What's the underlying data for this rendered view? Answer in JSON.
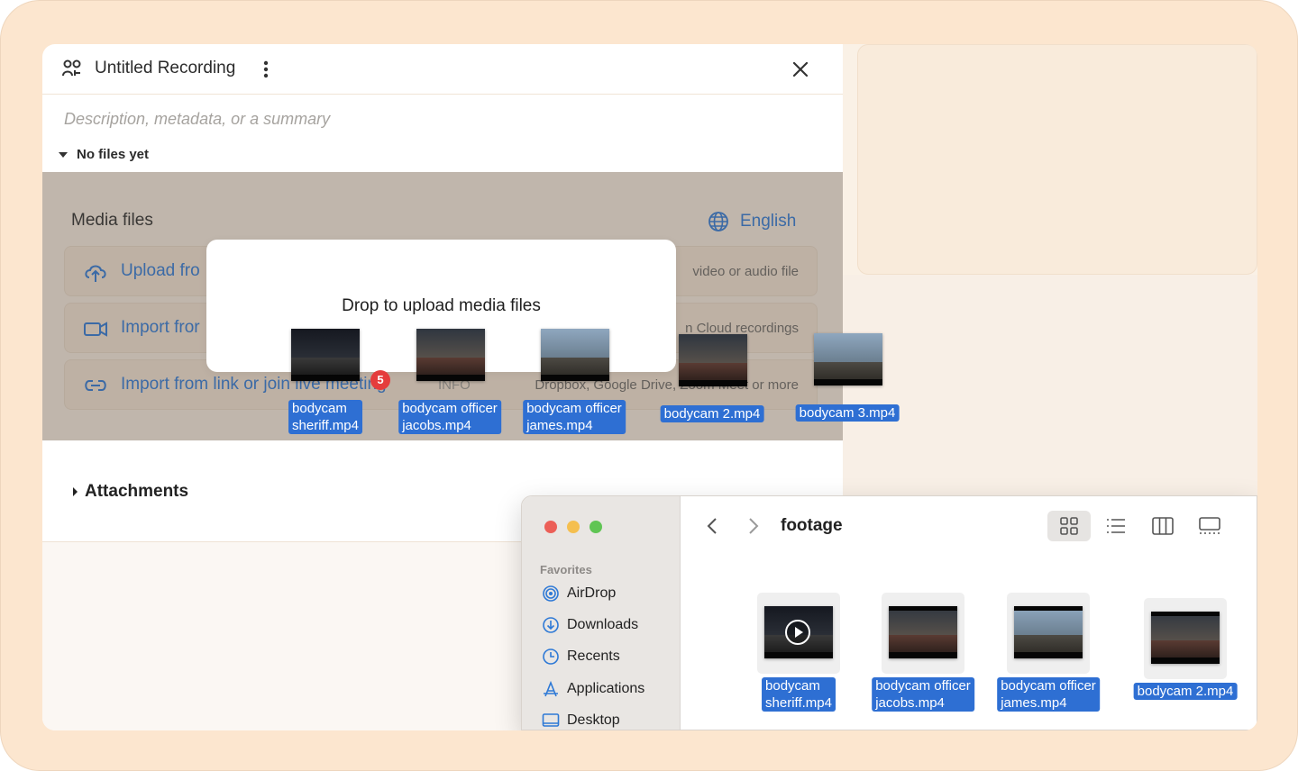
{
  "recording": {
    "title": "Untitled Recording",
    "description_placeholder": "Description, metadata, or a summary",
    "files_status": "No files yet"
  },
  "media": {
    "title": "Media files",
    "language": "English",
    "options": [
      {
        "label": "Upload fro",
        "hint": "video or audio file"
      },
      {
        "label": "Import fror",
        "hint": "n Cloud recordings"
      },
      {
        "label": "Import from link or join live meeting",
        "tag": "INFO",
        "hint": "Dropbox, Google Drive, Zoom Meet or more"
      }
    ]
  },
  "drop": {
    "message": "Drop to upload media files",
    "count_badge": "5"
  },
  "dragged_files": [
    {
      "name_line1": "bodycam",
      "name_line2": "sheriff.mp4"
    },
    {
      "name_line1": "bodycam officer",
      "name_line2": "jacobs.mp4"
    },
    {
      "name_line1": "bodycam officer",
      "name_line2": "james.mp4"
    },
    {
      "name": "bodycam 2.mp4"
    },
    {
      "name": "bodycam 3.mp4"
    }
  ],
  "attachments": {
    "label": "Attachments"
  },
  "finder": {
    "folder": "footage",
    "sidebar_section": "Favorites",
    "sidebar_items": [
      "AirDrop",
      "Downloads",
      "Recents",
      "Applications",
      "Desktop"
    ],
    "files": [
      {
        "name_line1": "bodycam",
        "name_line2": "sheriff.mp4"
      },
      {
        "name_line1": "bodycam officer",
        "name_line2": "jacobs.mp4"
      },
      {
        "name_line1": "bodycam officer",
        "name_line2": "james.mp4"
      },
      {
        "name": "bodycam 2.mp4"
      }
    ]
  },
  "colors": {
    "accent": "#2e79d6",
    "selection": "#2e6fd3",
    "frame": "#fce6cf",
    "badge": "#e53c3c"
  }
}
